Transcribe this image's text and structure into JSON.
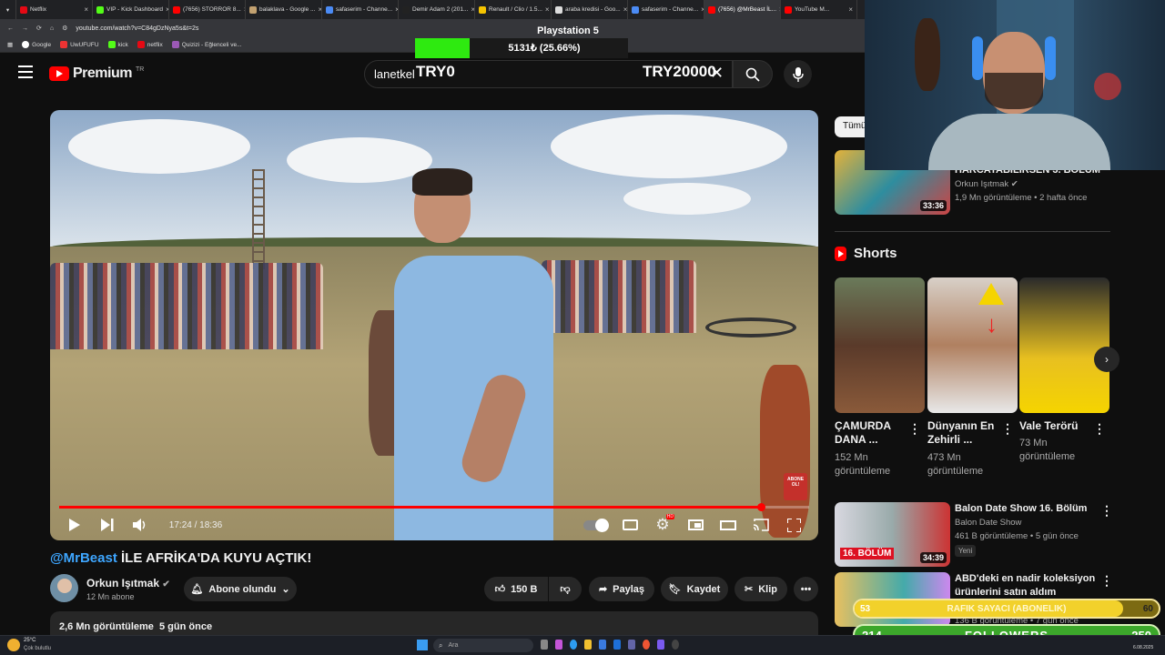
{
  "browser": {
    "tabs": [
      {
        "label": "Netflix",
        "color": "#e50914",
        "active": false
      },
      {
        "label": "VIP - Kick Dashboard",
        "color": "#53fc18",
        "active": false
      },
      {
        "label": "(7656) STORROR 8...",
        "color": "#ff0000",
        "active": false
      },
      {
        "label": "balaklava - Google ...",
        "color": "#c2a170",
        "active": false
      },
      {
        "label": "safaserim - Channe...",
        "color": "#4b8bf5",
        "active": false
      },
      {
        "label": "Demir Adam 2 (201...",
        "color": "#222222",
        "active": false
      },
      {
        "label": "Renault / Clio / 1.5...",
        "color": "#f5c400",
        "active": false
      },
      {
        "label": "araba kredisi - Goo...",
        "color": "#dddddd",
        "active": false
      },
      {
        "label": "safaserim - Channe...",
        "color": "#4b8bf5",
        "active": false
      },
      {
        "label": "(7656) @MrBeast İL...",
        "color": "#ff0000",
        "active": true
      },
      {
        "label": "YouTube M...",
        "color": "#ff0000",
        "active": false
      }
    ],
    "url": "youtube.com/watch?v=C84gDzNya5s&t=2s",
    "bookmarks": [
      "Google",
      "UwUFUFU",
      "kick",
      "netflix",
      "Quizizi - Eğlenceli ve..."
    ]
  },
  "overlay": {
    "goal_title": "Playstation 5",
    "goal_progress_text": "5131₺ (25.66%)",
    "goal_percent": 25.66,
    "try_left": "TRY0",
    "try_right": "TRY20000",
    "raffle_left": "53",
    "raffle_label": "RAFIK SAYACI (ABONELIK)",
    "raffle_right": "60",
    "raffle_fraction": 0.883,
    "followers_count": "214",
    "followers_label": "FOLLOWERS",
    "followers_goal": "250"
  },
  "youtube": {
    "logo_text": "Premium",
    "logo_region": "TR",
    "search_value": "lanetkel",
    "video": {
      "time": "17:24 / 18:36",
      "progress_fraction": 0.935,
      "abone_badge": "ABONE OL!",
      "title_handle": "@MrBeast",
      "title_rest": " İLE AFRİKA'DA KUYU AÇTIK!",
      "channel_name": "Orkun Işıtmak",
      "channel_subs": "12 Mn abone",
      "subscribe_label": "Abone olundu",
      "like_count": "150 B",
      "share_label": "Paylaş",
      "save_label": "Kaydet",
      "clip_label": "Klip",
      "views_date": "2,6 Mn görüntüleme  5 gün önce"
    },
    "sidebar": {
      "chip_label": "Tümü",
      "top_video": {
        "title": "HARCAYABİLİRSEN 3. BÖLÜM",
        "channel": "Orkun Işıtmak",
        "meta": "1,9 Mn görüntüleme • 2 hafta önce",
        "duration": "33:36"
      },
      "shorts_label": "Shorts",
      "shorts": [
        {
          "title1": "ÇAMURDA",
          "title2": "DANA ...",
          "views1": "152 Mn",
          "views2": "görüntüleme"
        },
        {
          "title1": "Dünyanın En",
          "title2": "Zehirli ...",
          "views1": "473 Mn",
          "views2": "görüntüleme"
        },
        {
          "title1": "Vale Terörü",
          "title2": "",
          "views1": "73 Mn",
          "views2": "görüntüleme"
        }
      ],
      "videos": [
        {
          "title1": "Balon Date Show 16. Bölüm",
          "title2": "",
          "channel": "Balon Date Show",
          "meta": "461 B görüntüleme • 5 gün önce",
          "badge": "Yeni",
          "duration": "34:39",
          "thumb_label": "16. BÖLÜM"
        },
        {
          "title1": "ABD'deki en nadir koleksiyon",
          "title2": "ürünlerini satın aldım",
          "channel": "",
          "meta": "136 B görüntüleme • 7 gün önce",
          "badge": "",
          "duration": "",
          "thumb_label": ""
        }
      ]
    }
  },
  "taskbar": {
    "weather_temp": "25°C",
    "weather_desc": "Çok bulutlu",
    "search_placeholder": "Ara",
    "time": "6.08.2025"
  },
  "colors": {
    "accent_red": "#ff0000",
    "link_blue": "#3ea6ff",
    "goal_green": "#2eea10",
    "followers_green": "#3ca72b",
    "raffle_gold": "#f2d12b"
  }
}
